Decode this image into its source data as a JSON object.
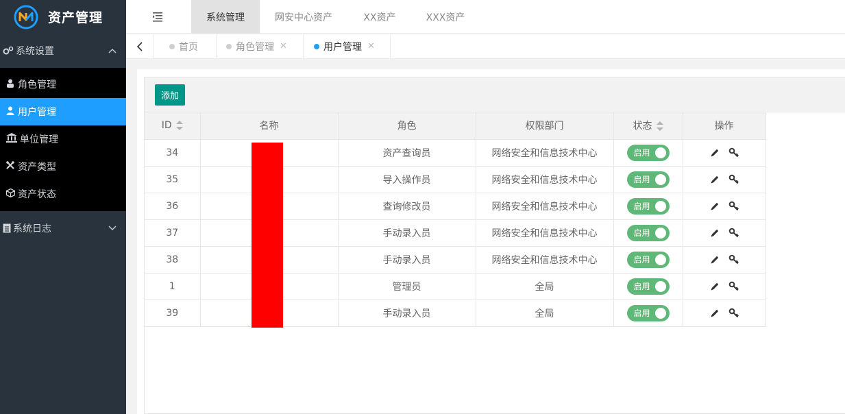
{
  "app": {
    "title": "资产管理"
  },
  "sidebar": {
    "groups": [
      {
        "label": "系统设置",
        "expanded": true,
        "items": [
          {
            "label": "角色管理",
            "icon": "users-icon",
            "active": false
          },
          {
            "label": "用户管理",
            "icon": "user-icon",
            "active": true
          },
          {
            "label": "单位管理",
            "icon": "bank-icon",
            "active": false
          },
          {
            "label": "资产类型",
            "icon": "wrench-icon",
            "active": false
          },
          {
            "label": "资产状态",
            "icon": "cube-icon",
            "active": false
          }
        ]
      },
      {
        "label": "系统日志",
        "expanded": false,
        "items": []
      }
    ]
  },
  "topnav": {
    "tabs": [
      {
        "label": "系统管理",
        "active": true
      },
      {
        "label": "网安中心资产",
        "active": false
      },
      {
        "label": "XX资产",
        "active": false
      },
      {
        "label": "XXX资产",
        "active": false
      }
    ]
  },
  "pagetabs": [
    {
      "label": "首页",
      "closable": false,
      "active": false
    },
    {
      "label": "角色管理",
      "closable": true,
      "active": false
    },
    {
      "label": "用户管理",
      "closable": true,
      "active": true
    }
  ],
  "toolbar": {
    "add_label": "添加"
  },
  "table": {
    "columns": [
      "ID",
      "名称",
      "角色",
      "权限部门",
      "状态",
      "操作"
    ],
    "rows": [
      {
        "id": "34",
        "name": "",
        "role": "资产查询员",
        "dept": "网络安全和信息技术中心",
        "status": "启用"
      },
      {
        "id": "35",
        "name": "",
        "role": "导入操作员",
        "dept": "网络安全和信息技术中心",
        "status": "启用"
      },
      {
        "id": "36",
        "name": "",
        "role": "查询修改员",
        "dept": "网络安全和信息技术中心",
        "status": "启用"
      },
      {
        "id": "37",
        "name": "",
        "role": "手动录入员",
        "dept": "网络安全和信息技术中心",
        "status": "启用"
      },
      {
        "id": "38",
        "name": "",
        "role": "手动录入员",
        "dept": "网络安全和信息技术中心",
        "status": "启用"
      },
      {
        "id": "1",
        "name": "",
        "role": "管理员",
        "dept": "全局",
        "status": "启用"
      },
      {
        "id": "39",
        "name": "",
        "role": "手动录入员",
        "dept": "全局",
        "status": "启用"
      }
    ]
  },
  "colors": {
    "sidebar_bg": "#28333e",
    "submenu_bg": "#000000",
    "active_item": "#1e9fff",
    "add_button": "#009688",
    "switch_on": "#5fb878",
    "redaction": "#ff0000"
  }
}
